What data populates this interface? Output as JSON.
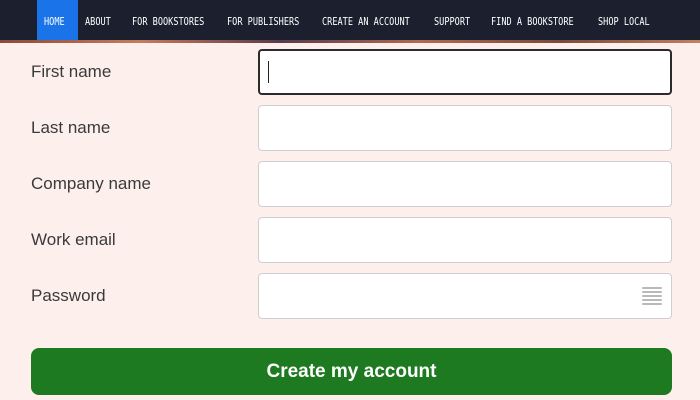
{
  "nav": {
    "items": [
      {
        "label": "HOME",
        "active": true
      },
      {
        "label": "ABOUT",
        "active": false
      },
      {
        "label": "FOR BOOKSTORES",
        "active": false
      },
      {
        "label": "FOR PUBLISHERS",
        "active": false
      },
      {
        "label": "CREATE AN ACCOUNT",
        "active": false
      },
      {
        "label": "SUPPORT",
        "active": false
      },
      {
        "label": "FIND A BOOKSTORE",
        "active": false
      },
      {
        "label": "SHOP LOCAL",
        "active": false
      }
    ]
  },
  "form": {
    "fields": [
      {
        "label": "First name",
        "value": "",
        "placeholder": ""
      },
      {
        "label": "Last name",
        "value": "",
        "placeholder": ""
      },
      {
        "label": "Company name",
        "value": "",
        "placeholder": ""
      },
      {
        "label": "Work email",
        "value": "",
        "placeholder": ""
      },
      {
        "label": "Password",
        "value": "",
        "placeholder": ""
      }
    ],
    "submit_label": "Create my account",
    "password_icon": "password-manager-icon"
  },
  "colors": {
    "nav_bg": "#1b1f2e",
    "nav_active": "#1a73e8",
    "page_bg": "#fdf0ec",
    "submit_bg": "#1e7a20"
  }
}
